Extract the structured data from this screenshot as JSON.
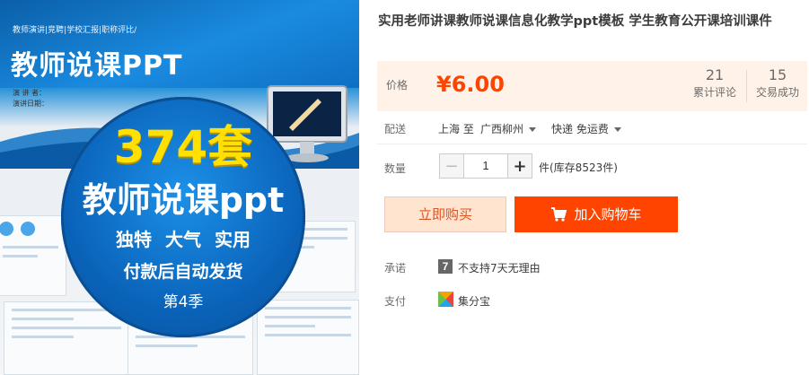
{
  "product_image": {
    "subline": "教师演讲|竞聘|学校汇报|职称评比/",
    "title": "教师说课PPT",
    "presenter_line1": "演 讲 者：",
    "presenter_line2": "演讲日期：",
    "badge_count": "374套",
    "badge_name": "教师说课ppt",
    "badge_features": "独特 大气 实用",
    "badge_delivery": "付款后自动发货",
    "badge_season": "第4季"
  },
  "product": {
    "title": "实用老师讲课教师说课信息化教学ppt模板 学生教育公开课培训课件"
  },
  "price": {
    "label": "价格",
    "value": "¥6.00",
    "reviews_count": "21",
    "reviews_label": "累计评论",
    "deals_count": "15",
    "deals_label": "交易成功"
  },
  "shipping": {
    "label": "配送",
    "from": "上海 至",
    "to": "广西柳州",
    "method": "快递 免运费"
  },
  "quantity": {
    "label": "数量",
    "minus": "−",
    "value": "1",
    "plus": "+",
    "stock": "件(库存8523件)"
  },
  "actions": {
    "buy_now": "立即购买",
    "add_to_cart": "加入购物车"
  },
  "promise": {
    "label": "承诺",
    "icon_glyph": "7",
    "text": "不支持7天无理由"
  },
  "payment": {
    "label": "支付",
    "text": "集分宝"
  },
  "colors": {
    "accent": "#ff4400",
    "price_bg": "#fff2e8",
    "buy_bg": "#ffe4d0"
  }
}
